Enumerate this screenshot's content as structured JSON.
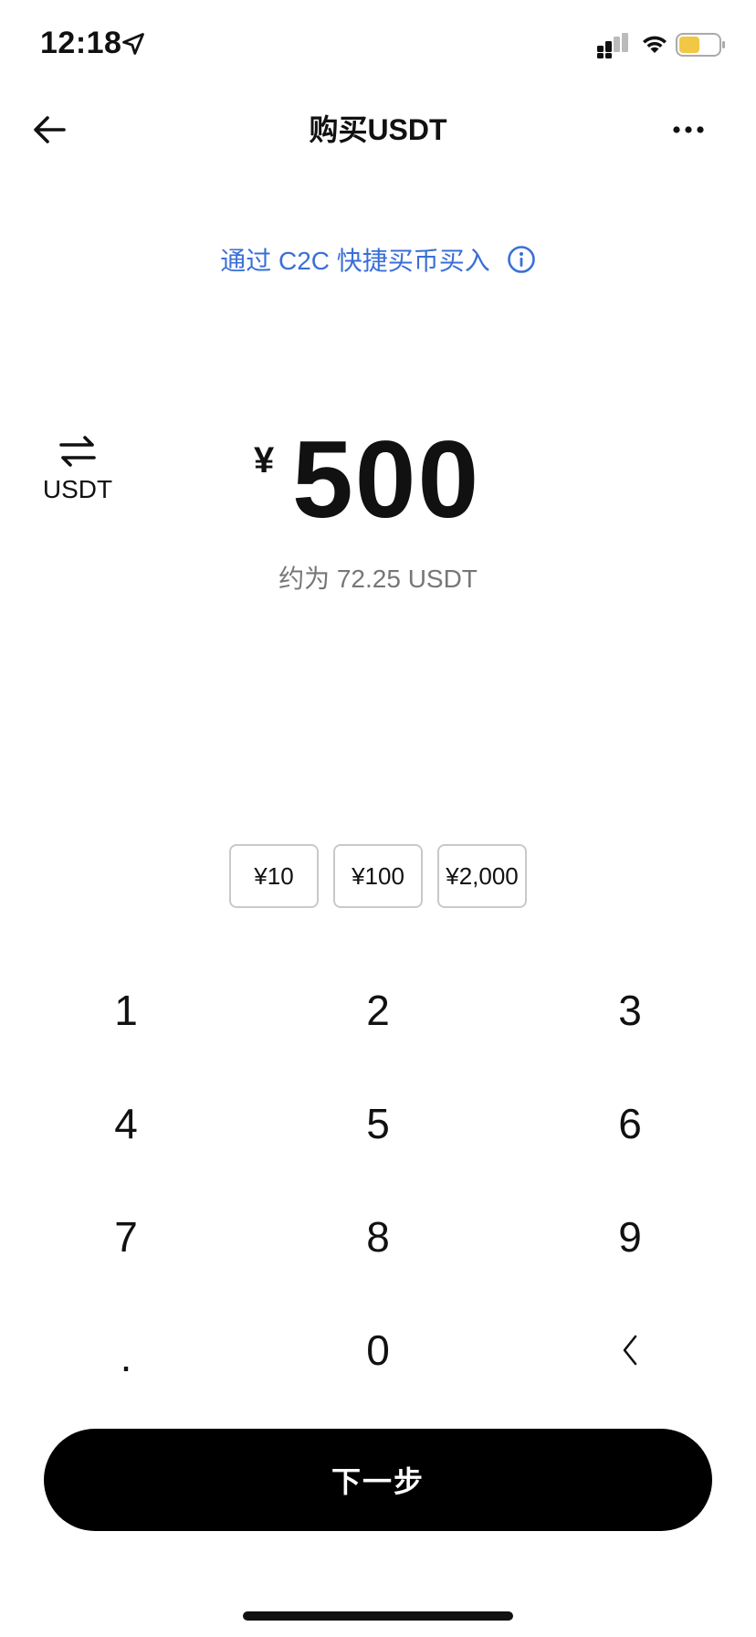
{
  "status_bar": {
    "time": "12:18",
    "battery_color": "#f2c744"
  },
  "nav": {
    "title": "购买USDT",
    "back_icon": "arrow-left-icon",
    "more_icon": "more-dots-icon"
  },
  "c2c": {
    "link_text": "通过 C2C 快捷买币买入",
    "link_color": "#3a6fd8",
    "info_icon": "info-icon"
  },
  "amount": {
    "switch_label": "USDT",
    "currency_symbol": "¥",
    "value": "500",
    "approx_text": "约为 72.25 USDT"
  },
  "quick_amounts": [
    "¥10",
    "¥100",
    "¥2,000"
  ],
  "keypad": {
    "keys": [
      "1",
      "2",
      "3",
      "4",
      "5",
      "6",
      "7",
      "8",
      "9",
      ".",
      "0",
      "‹"
    ]
  },
  "next_button": {
    "label": "下一步",
    "color": "#000000"
  }
}
